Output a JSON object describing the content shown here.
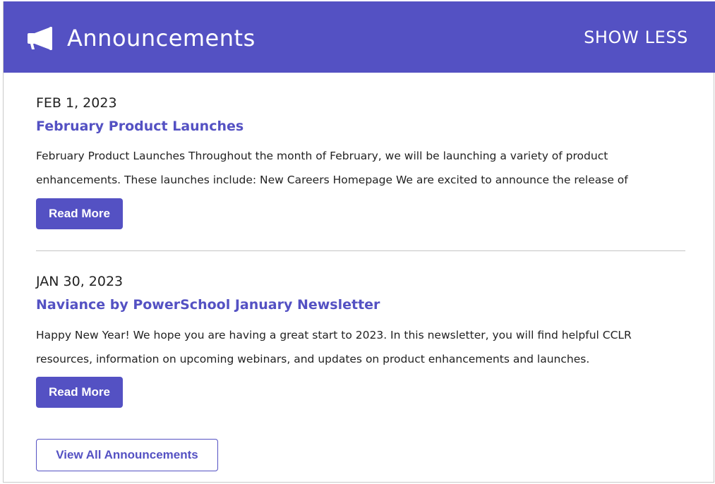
{
  "header": {
    "title": "Announcements",
    "show_less_label": "SHOW LESS",
    "icon": "megaphone-icon"
  },
  "announcements": [
    {
      "date": "FEB 1, 2023",
      "title": "February Product Launches",
      "body_line1": "February Product Launches Throughout the month of February, we will be launching a variety of product",
      "body_line2": "enhancements. These launches include: New Careers Homepage We are excited to announce the release of",
      "read_more_label": "Read More"
    },
    {
      "date": "JAN 30, 2023",
      "title": "Naviance by PowerSchool January Newsletter",
      "body_line1": "Happy New Year! We hope you are having a great start to 2023. In this newsletter, you will find helpful CCLR",
      "body_line2": "resources, information on upcoming webinars, and updates on product enhancements and launches.",
      "read_more_label": "Read More"
    }
  ],
  "footer": {
    "view_all_label": "View All Announcements"
  },
  "colors": {
    "accent": "#5451c3",
    "text": "#222222",
    "divider": "#c4c4c4"
  }
}
